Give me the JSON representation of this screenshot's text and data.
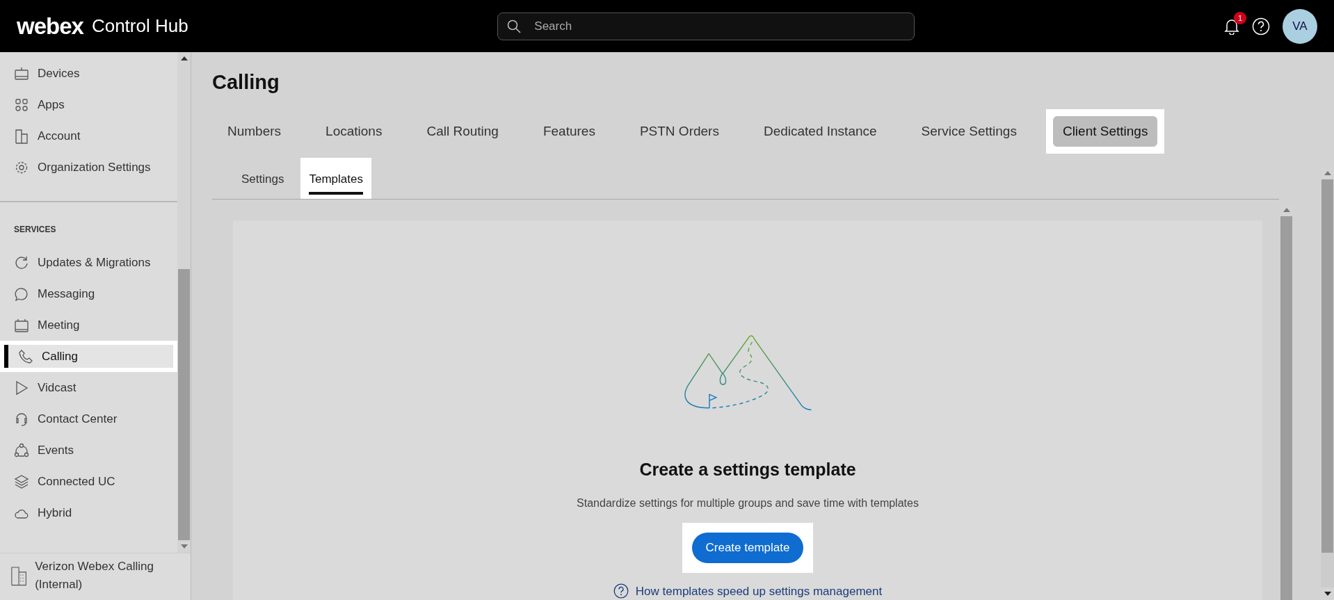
{
  "header": {
    "brand": "webex",
    "product": "Control Hub",
    "search": {
      "placeholder": "Search"
    },
    "notification_count": "1",
    "avatar": "VA"
  },
  "sidebar": {
    "items": [
      {
        "label": "Devices",
        "selected": false,
        "highlighted": false
      },
      {
        "label": "Apps",
        "selected": false,
        "highlighted": false
      },
      {
        "label": "Account",
        "selected": false,
        "highlighted": false
      },
      {
        "label": "Organization Settings",
        "selected": false,
        "highlighted": false
      }
    ],
    "section_title": "SERVICES",
    "services": [
      {
        "label": "Updates & Migrations",
        "selected": false,
        "highlighted": false
      },
      {
        "label": "Messaging",
        "selected": false,
        "highlighted": false
      },
      {
        "label": "Meeting",
        "selected": false,
        "highlighted": false
      },
      {
        "label": "Calling",
        "selected": true,
        "highlighted": true
      },
      {
        "label": "Vidcast",
        "selected": false,
        "highlighted": false
      },
      {
        "label": "Contact Center",
        "selected": false,
        "highlighted": false
      },
      {
        "label": "Events",
        "selected": false,
        "highlighted": false
      },
      {
        "label": "Connected UC",
        "selected": false,
        "highlighted": false
      },
      {
        "label": "Hybrid",
        "selected": false,
        "highlighted": false
      }
    ],
    "organization": "Verizon Webex Calling (Internal)"
  },
  "page_title": "Calling",
  "tabs": [
    {
      "label": "Numbers",
      "selected": false,
      "highlighted": false
    },
    {
      "label": "Locations",
      "selected": false,
      "highlighted": false
    },
    {
      "label": "Call Routing",
      "selected": false,
      "highlighted": false
    },
    {
      "label": "Features",
      "selected": false,
      "highlighted": false
    },
    {
      "label": "PSTN Orders",
      "selected": false,
      "highlighted": false
    },
    {
      "label": "Dedicated Instance",
      "selected": false,
      "highlighted": false
    },
    {
      "label": "Service Settings",
      "selected": false,
      "highlighted": false
    },
    {
      "label": "Client Settings",
      "selected": true,
      "highlighted": true
    }
  ],
  "subtabs": [
    {
      "label": "Settings",
      "selected": false,
      "highlighted": false
    },
    {
      "label": "Templates",
      "selected": true,
      "highlighted": true
    }
  ],
  "empty_state": {
    "heading": "Create a settings template",
    "description": "Standardize settings for multiple groups and save time with templates",
    "button": {
      "label": "Create template",
      "highlighted": true
    },
    "help_link": "How templates speed up settings management"
  }
}
